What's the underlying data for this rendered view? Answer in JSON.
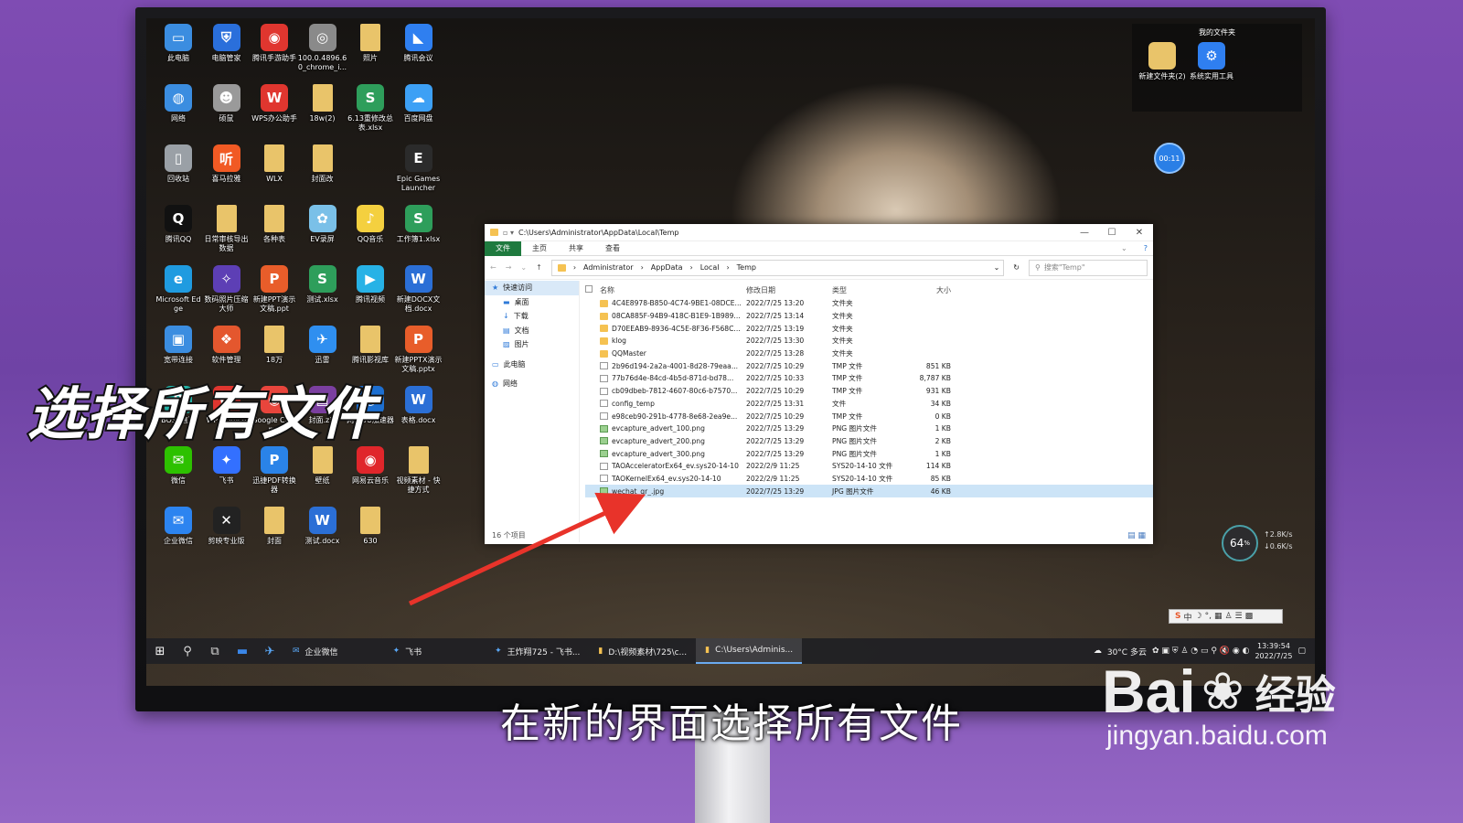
{
  "desktop": {
    "icons": [
      {
        "label": "此电脑",
        "icon": "computer-icon",
        "color": "#3b8de0",
        "glyph": "▭"
      },
      {
        "label": "电脑管家",
        "icon": "shield-icon",
        "color": "#2a6fdb",
        "glyph": "⛨"
      },
      {
        "label": "腾讯手游助手",
        "icon": "gamepad-icon",
        "color": "#e0362f",
        "glyph": "◉"
      },
      {
        "label": "100.0.4896.60_chrome_i...",
        "icon": "installer-icon",
        "color": "#8a8a8a",
        "glyph": "◎"
      },
      {
        "label": "照片",
        "icon": "folder-icon",
        "color": "#e9c46a",
        "glyph": ""
      },
      {
        "label": "腾讯会议",
        "icon": "meeting-icon",
        "color": "#2f7ff0",
        "glyph": "◣"
      },
      {
        "label": "网络",
        "icon": "network-icon",
        "color": "#3b8de0",
        "glyph": "◍"
      },
      {
        "label": "硕鼠",
        "icon": "mouse-icon",
        "color": "#9a9a9a",
        "glyph": "☻"
      },
      {
        "label": "WPS办公助手",
        "icon": "wps-icon",
        "color": "#e0362f",
        "glyph": "W"
      },
      {
        "label": "18w(2)",
        "icon": "folder-icon",
        "color": "#e9c46a",
        "glyph": ""
      },
      {
        "label": "6.13重修改总表.xlsx",
        "icon": "xlsx-icon",
        "color": "#2e9e5b",
        "glyph": "S"
      },
      {
        "label": "百度网盘",
        "icon": "cloud-icon",
        "color": "#3da0f5",
        "glyph": "☁"
      },
      {
        "label": "回收站",
        "icon": "recycle-bin-icon",
        "color": "#9aa0a6",
        "glyph": "▯"
      },
      {
        "label": "喜马拉雅",
        "icon": "audio-icon",
        "color": "#f15a24",
        "glyph": "听"
      },
      {
        "label": "WLX",
        "icon": "folder-icon",
        "color": "#e9c46a",
        "glyph": ""
      },
      {
        "label": "封面改",
        "icon": "folder-icon",
        "color": "#e9c46a",
        "glyph": ""
      },
      {
        "label": "",
        "icon": "",
        "color": "",
        "glyph": ""
      },
      {
        "label": "Epic Games Launcher",
        "icon": "epic-icon",
        "color": "#2b2b2b",
        "glyph": "E"
      },
      {
        "label": "腾讯QQ",
        "icon": "qq-icon",
        "color": "#111",
        "glyph": "Q"
      },
      {
        "label": "日常审核导出数据",
        "icon": "folder-icon",
        "color": "#e9c46a",
        "glyph": ""
      },
      {
        "label": "各种表",
        "icon": "folder-icon",
        "color": "#e9c46a",
        "glyph": ""
      },
      {
        "label": "EV录屏",
        "icon": "recorder-icon",
        "color": "#7ac0e8",
        "glyph": "✿"
      },
      {
        "label": "QQ音乐",
        "icon": "music-icon",
        "color": "#f4d03f",
        "glyph": "♪"
      },
      {
        "label": "工作簿1.xlsx",
        "icon": "xlsx-icon",
        "color": "#2e9e5b",
        "glyph": "S"
      },
      {
        "label": "Microsoft Edge",
        "icon": "edge-icon",
        "color": "#1f9be0",
        "glyph": "e"
      },
      {
        "label": "数码照片压缩大师",
        "icon": "wizard-icon",
        "color": "#5d3fb5",
        "glyph": "✧"
      },
      {
        "label": "新建PPT演示文稿.ppt",
        "icon": "ppt-icon",
        "color": "#e85d2a",
        "glyph": "P"
      },
      {
        "label": "测试.xlsx",
        "icon": "xlsx-icon",
        "color": "#2e9e5b",
        "glyph": "S"
      },
      {
        "label": "腾讯视频",
        "icon": "video-icon",
        "color": "#27b2e6",
        "glyph": "▶"
      },
      {
        "label": "新建DOCX文档.docx",
        "icon": "docx-icon",
        "color": "#2b6fd6",
        "glyph": "W"
      },
      {
        "label": "宽带连接",
        "icon": "broadband-icon",
        "color": "#3b8de0",
        "glyph": "▣"
      },
      {
        "label": "软件管理",
        "icon": "software-icon",
        "color": "#e4572e",
        "glyph": "❖"
      },
      {
        "label": "18万",
        "icon": "folder-icon",
        "color": "#e9c46a",
        "glyph": ""
      },
      {
        "label": "迅雷",
        "icon": "thunder-icon",
        "color": "#2f8ff0",
        "glyph": "✈"
      },
      {
        "label": "腾讯影视库",
        "icon": "folder-icon",
        "color": "#e9c46a",
        "glyph": ""
      },
      {
        "label": "新建PPTX演示文稿.pptx",
        "icon": "ppt-icon",
        "color": "#e85d2a",
        "glyph": "P"
      },
      {
        "label": "BOSS直聘",
        "icon": "boss-icon",
        "color": "#22b2a6",
        "glyph": "B"
      },
      {
        "label": "WPS Office",
        "icon": "wps-icon",
        "color": "#e0362f",
        "glyph": "W"
      },
      {
        "label": "Google Chrome",
        "icon": "chrome-icon",
        "color": "#e8453c",
        "glyph": "◉"
      },
      {
        "label": "封面.zip",
        "icon": "zip-icon",
        "color": "#7b3fa0",
        "glyph": "▤"
      },
      {
        "label": "网易UU加速器",
        "icon": "uu-icon",
        "color": "#1d6fd1",
        "glyph": "◎"
      },
      {
        "label": "表格.docx",
        "icon": "docx-icon",
        "color": "#2b6fd6",
        "glyph": "W"
      },
      {
        "label": "微信",
        "icon": "wechat-icon",
        "color": "#2dc100",
        "glyph": "✉"
      },
      {
        "label": "飞书",
        "icon": "feishu-icon",
        "color": "#3370ff",
        "glyph": "✦"
      },
      {
        "label": "迅捷PDF转换器",
        "icon": "pdf-icon",
        "color": "#2a83e8",
        "glyph": "P"
      },
      {
        "label": "壁纸",
        "icon": "folder-icon",
        "color": "#e9c46a",
        "glyph": ""
      },
      {
        "label": "网易云音乐",
        "icon": "netease-music-icon",
        "color": "#e0262b",
        "glyph": "◉"
      },
      {
        "label": "视频素材 - 快捷方式",
        "icon": "folder-icon",
        "color": "#e9c46a",
        "glyph": ""
      },
      {
        "label": "企业微信",
        "icon": "wecom-icon",
        "color": "#2c84f0",
        "glyph": "✉"
      },
      {
        "label": "剪映专业版",
        "icon": "capcut-icon",
        "color": "#222",
        "glyph": "✕"
      },
      {
        "label": "封面",
        "icon": "folder-icon",
        "color": "#e9c46a",
        "glyph": ""
      },
      {
        "label": "测试.docx",
        "icon": "docx-icon",
        "color": "#2b6fd6",
        "glyph": "W"
      },
      {
        "label": "630",
        "icon": "folder-icon",
        "color": "#e9c46a",
        "glyph": ""
      }
    ],
    "my_files": {
      "title": "我的文件夹",
      "items": [
        {
          "label": "新建文件夹(2)",
          "icon": "folder-icon",
          "color": "#e9c46a",
          "glyph": ""
        },
        {
          "label": "系统实用工具",
          "icon": "gear-icon",
          "color": "#2f7ff0",
          "glyph": "⚙"
        }
      ]
    },
    "timer": "00:11",
    "net_widget": {
      "percent": "64",
      "unit": "%",
      "up": "2.8",
      "down": "0.6",
      "speed_unit": "K/s"
    }
  },
  "caption": "选择所有文件",
  "subtitle": "在新的界面选择所有文件",
  "watermark": {
    "brand": "Bai",
    "brand_suffix": "经验",
    "url": "jingyan.baidu.com"
  },
  "explorer": {
    "title": "C:\\Users\\Administrator\\AppData\\Local\\Temp",
    "ribbon": [
      "文件",
      "主页",
      "共享",
      "查看"
    ],
    "path": [
      "Administrator",
      "AppData",
      "Local",
      "Temp"
    ],
    "search_placeholder": "搜索\"Temp\"",
    "nav": [
      {
        "label": "快速访问",
        "icon": "star-icon"
      },
      {
        "label": "桌面",
        "icon": "desktop-icon"
      },
      {
        "label": "下载",
        "icon": "download-icon"
      },
      {
        "label": "文档",
        "icon": "document-icon"
      },
      {
        "label": "图片",
        "icon": "picture-icon"
      },
      {
        "label": "此电脑",
        "icon": "computer-icon"
      },
      {
        "label": "网络",
        "icon": "network-icon"
      }
    ],
    "columns": {
      "name": "名称",
      "date": "修改日期",
      "type": "类型",
      "size": "大小"
    },
    "files": [
      {
        "name": "4C4E8978-B850-4C74-9BE1-08DCE...",
        "date": "2022/7/25 13:20",
        "type": "文件夹",
        "size": "",
        "kind": "folder"
      },
      {
        "name": "08CA885F-94B9-418C-B1E9-1B989...",
        "date": "2022/7/25 13:14",
        "type": "文件夹",
        "size": "",
        "kind": "folder"
      },
      {
        "name": "D70EEAB9-8936-4C5E-8F36-F568C...",
        "date": "2022/7/25 13:19",
        "type": "文件夹",
        "size": "",
        "kind": "folder"
      },
      {
        "name": "klog",
        "date": "2022/7/25 13:30",
        "type": "文件夹",
        "size": "",
        "kind": "folder"
      },
      {
        "name": "QQMaster",
        "date": "2022/7/25 13:28",
        "type": "文件夹",
        "size": "",
        "kind": "folder"
      },
      {
        "name": "2b96d194-2a2a-4001-8d28-79eaa...",
        "date": "2022/7/25 10:29",
        "type": "TMP 文件",
        "size": "851 KB",
        "kind": "file"
      },
      {
        "name": "77b76d4e-84cd-4b5d-871d-bd78...",
        "date": "2022/7/25 10:33",
        "type": "TMP 文件",
        "size": "8,787 KB",
        "kind": "file"
      },
      {
        "name": "cb09dbeb-7812-4607-80c6-b7570...",
        "date": "2022/7/25 10:29",
        "type": "TMP 文件",
        "size": "931 KB",
        "kind": "file"
      },
      {
        "name": "config_temp",
        "date": "2022/7/25 13:31",
        "type": "文件",
        "size": "34 KB",
        "kind": "file"
      },
      {
        "name": "e98ceb90-291b-4778-8e68-2ea9e...",
        "date": "2022/7/25 10:29",
        "type": "TMP 文件",
        "size": "0 KB",
        "kind": "file"
      },
      {
        "name": "evcapture_advert_100.png",
        "date": "2022/7/25 13:29",
        "type": "PNG 图片文件",
        "size": "1 KB",
        "kind": "img"
      },
      {
        "name": "evcapture_advert_200.png",
        "date": "2022/7/25 13:29",
        "type": "PNG 图片文件",
        "size": "2 KB",
        "kind": "img"
      },
      {
        "name": "evcapture_advert_300.png",
        "date": "2022/7/25 13:29",
        "type": "PNG 图片文件",
        "size": "1 KB",
        "kind": "img"
      },
      {
        "name": "TAOAcceleratorEx64_ev.sys20-14-10",
        "date": "2022/2/9 11:25",
        "type": "SYS20-14-10 文件",
        "size": "114 KB",
        "kind": "file"
      },
      {
        "name": "TAOKernelEx64_ev.sys20-14-10",
        "date": "2022/2/9 11:25",
        "type": "SYS20-14-10 文件",
        "size": "85 KB",
        "kind": "file"
      },
      {
        "name": "wechat_qr_.jpg",
        "date": "2022/7/25 13:29",
        "type": "JPG 图片文件",
        "size": "46 KB",
        "kind": "img"
      }
    ],
    "status": "16 个项目"
  },
  "taskbar": {
    "apps": [
      {
        "label": "企业微信",
        "icon": "wecom-icon",
        "active": false
      },
      {
        "label": "飞书",
        "icon": "feishu-icon",
        "active": false
      },
      {
        "label": "王炸翔725 - 飞书...",
        "icon": "feishu-icon",
        "active": false
      },
      {
        "label": "D:\\视频素材\\725\\c...",
        "icon": "folder-icon",
        "active": false
      },
      {
        "label": "C:\\Users\\Adminis...",
        "icon": "folder-icon",
        "active": true
      }
    ],
    "weather": "30°C 多云",
    "time": "13:39:54",
    "date": "2022/7/25"
  }
}
